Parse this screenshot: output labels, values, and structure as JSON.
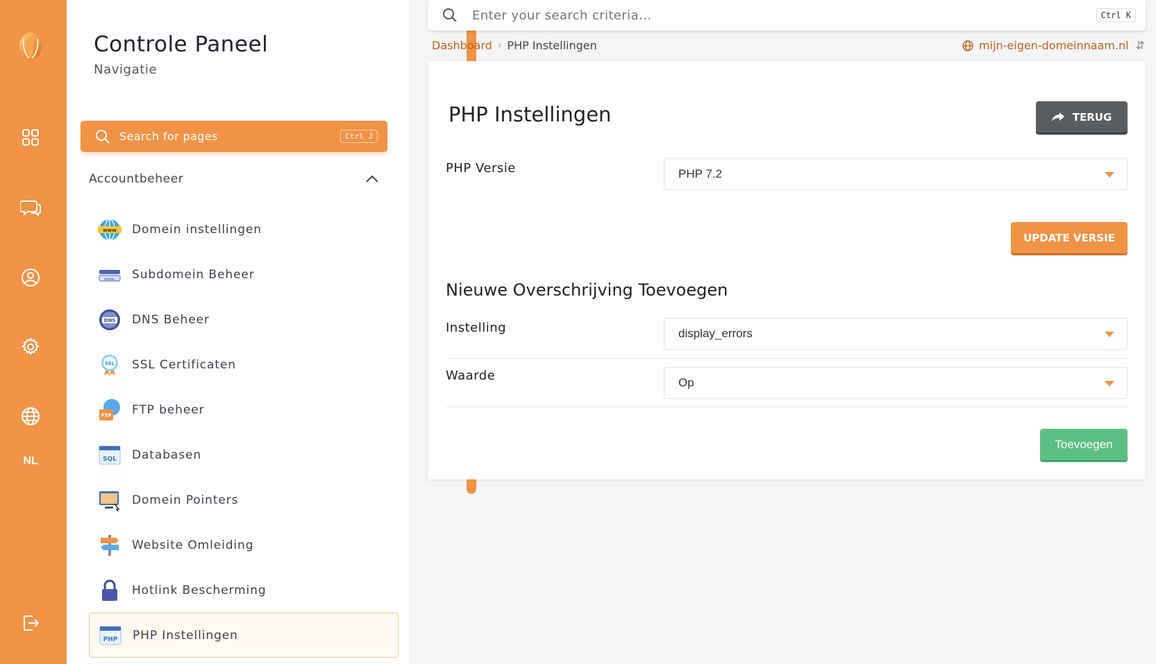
{
  "rail": {
    "icons": [
      "logo-icon",
      "dashboard-grid-icon",
      "chat-icon",
      "user-icon",
      "settings-icon",
      "globe-icon",
      "logout-icon"
    ],
    "language": "NL",
    "color": "#f09346"
  },
  "nav": {
    "title": "Controle Paneel",
    "subtitle": "Navigatie",
    "search_label": "Search for pages",
    "search_shortcut": "Ctrl J",
    "section": "Accountbeheer",
    "items": [
      {
        "label": "Domein instellingen",
        "icon": "www-globe-icon"
      },
      {
        "label": "Subdomein Beheer",
        "icon": "subdomain-icon"
      },
      {
        "label": "DNS Beheer",
        "icon": "dns-icon"
      },
      {
        "label": "SSL Certificaten",
        "icon": "ssl-badge-icon"
      },
      {
        "label": "FTP beheer",
        "icon": "ftp-icon"
      },
      {
        "label": "Databasen",
        "icon": "sql-icon"
      },
      {
        "label": "Domein Pointers",
        "icon": "domain-pointer-icon"
      },
      {
        "label": "Website Omleiding",
        "icon": "signpost-icon"
      },
      {
        "label": "Hotlink Bescherming",
        "icon": "lock-icon"
      },
      {
        "label": "PHP Instellingen",
        "icon": "php-icon",
        "active": true
      }
    ]
  },
  "topbar": {
    "placeholder": "Enter your search criteria...",
    "shortcut": "Ctrl K"
  },
  "breadcrumb": {
    "home": "Dashboard",
    "current": "PHP Instellingen"
  },
  "domain": "mijn-eigen-domeinnaam.nl",
  "main": {
    "title": "PHP Instellingen",
    "back_label": "TERUG",
    "php_version_label": "PHP Versie",
    "php_version_value": "PHP 7.2",
    "update_label": "UPDATE VERSIE",
    "override_title": "Nieuwe Overschrijving Toevoegen",
    "setting_label": "Instelling",
    "setting_value": "display_errors",
    "value_label": "Waarde",
    "value_value": "Op",
    "add_label": "Toevoegen"
  },
  "colors": {
    "accent": "#f09346",
    "back_button": "#5a5d60",
    "add_button": "#5dc083",
    "link": "#c0601a"
  }
}
